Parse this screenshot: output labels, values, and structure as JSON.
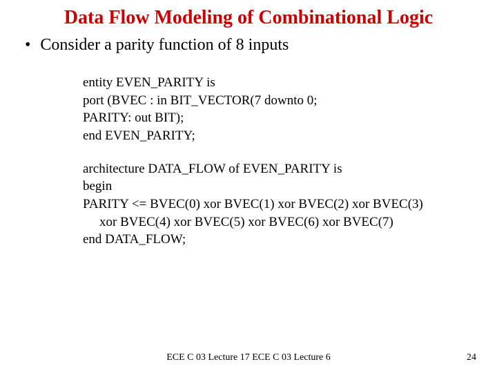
{
  "title": "Data Flow Modeling of Combinational Logic",
  "bullet": {
    "marker": "•",
    "text": "Consider a parity function of 8 inputs"
  },
  "entity": {
    "l1": "entity EVEN_PARITY is",
    "l2": "port (BVEC : in BIT_VECTOR(7 downto 0;",
    "l3": "PARITY: out BIT);",
    "l4": "end EVEN_PARITY;"
  },
  "arch": {
    "l1": "architecture DATA_FLOW of EVEN_PARITY is",
    "l2": "begin",
    "l3": "PARITY <= BVEC(0) xor BVEC(1) xor BVEC(2) xor BVEC(3)",
    "l4": "xor BVEC(4) xor BVEC(5) xor BVEC(6) xor BVEC(7)",
    "l5": "end DATA_FLOW;"
  },
  "footer": {
    "center": "ECE C 03 Lecture 17 ECE C 03 Lecture 6",
    "page": "24"
  }
}
